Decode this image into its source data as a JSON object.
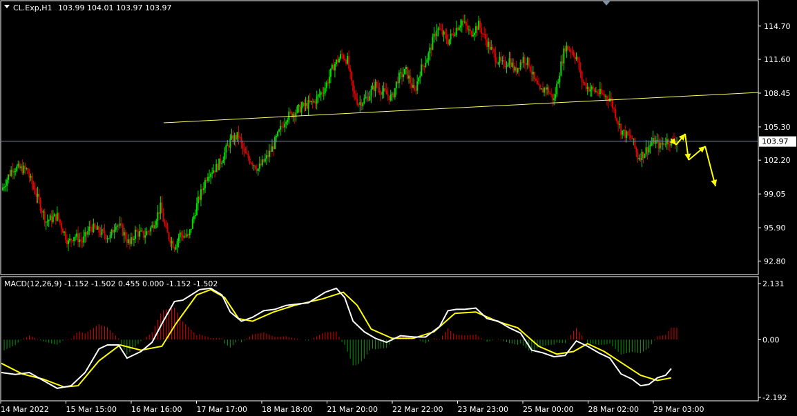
{
  "header": {
    "symbol": "CL.Exp,H1",
    "ohlc": "103.99 104.01 103.97 103.97"
  },
  "macd_header": {
    "text": "MACD(12,26,9) -1.152 -1.502 0.455 0.000 -1.152 -1.502"
  },
  "colors": {
    "background": "#000000",
    "frame": "#ffffff",
    "bull": "#00e000",
    "bear": "#e00000",
    "trendline": "#ffff66",
    "arrow": "#ffff00",
    "current_line": "#8090a0",
    "macd_line": "#ffffff",
    "signal_line": "#ffff00",
    "hist_pos": "#e00000",
    "hist_neg": "#00a000"
  },
  "chart_data": [
    {
      "type": "candlestick",
      "price_ticks": [
        "114.70",
        "111.60",
        "108.45",
        "105.30",
        "102.20",
        "99.05",
        "95.90",
        "92.80"
      ],
      "ylim": [
        91.6,
        117.0
      ],
      "current_price": "103.97",
      "time_labels": [
        "14 Mar 2022",
        "15 Mar 15:00",
        "16 Mar 16:00",
        "17 Mar 17:00",
        "18 Mar 18:00",
        "21 Mar 20:00",
        "22 Mar 22:00",
        "23 Mar 23:00",
        "25 Mar 00:00",
        "28 Mar 02:00",
        "29 Mar 03:00"
      ],
      "close_path": [
        [
          0,
          99.4
        ],
        [
          8,
          101.5
        ],
        [
          18,
          101.3
        ],
        [
          25,
          99.0
        ],
        [
          32,
          96.5
        ],
        [
          40,
          97.0
        ],
        [
          48,
          94.5
        ],
        [
          52,
          95.2
        ],
        [
          58,
          94.6
        ],
        [
          64,
          96.0
        ],
        [
          72,
          95.4
        ],
        [
          78,
          95.0
        ],
        [
          82,
          96.4
        ],
        [
          86,
          95.8
        ],
        [
          92,
          94.3
        ],
        [
          96,
          95.5
        ],
        [
          102,
          95.2
        ],
        [
          108,
          96.0
        ],
        [
          114,
          97.8
        ],
        [
          118,
          95.5
        ],
        [
          124,
          94.2
        ],
        [
          128,
          95.3
        ],
        [
          134,
          95.0
        ],
        [
          140,
          98.0
        ],
        [
          148,
          101.0
        ],
        [
          154,
          101.5
        ],
        [
          158,
          102.3
        ],
        [
          164,
          104.0
        ],
        [
          170,
          104.5
        ],
        [
          174,
          102.8
        ],
        [
          180,
          102.0
        ],
        [
          184,
          101.4
        ],
        [
          190,
          102.4
        ],
        [
          194,
          103.3
        ],
        [
          198,
          104.5
        ],
        [
          204,
          106.2
        ],
        [
          210,
          106.7
        ],
        [
          216,
          107.2
        ],
        [
          224,
          107.6
        ],
        [
          232,
          109.0
        ],
        [
          238,
          111.0
        ],
        [
          244,
          112.0
        ],
        [
          248,
          111.5
        ],
        [
          252,
          108.5
        ],
        [
          256,
          107.5
        ],
        [
          262,
          108.0
        ],
        [
          268,
          109.2
        ],
        [
          274,
          108.5
        ],
        [
          280,
          108.0
        ],
        [
          284,
          109.8
        ],
        [
          290,
          110.5
        ],
        [
          296,
          108.5
        ],
        [
          300,
          110.5
        ],
        [
          306,
          112.0
        ],
        [
          312,
          114.5
        ],
        [
          316,
          114.0
        ],
        [
          320,
          113.3
        ],
        [
          326,
          114.5
        ],
        [
          330,
          115.2
        ],
        [
          336,
          114.0
        ],
        [
          342,
          114.8
        ],
        [
          348,
          113.2
        ],
        [
          354,
          111.8
        ],
        [
          360,
          111.0
        ],
        [
          364,
          111.6
        ],
        [
          368,
          110.5
        ],
        [
          374,
          111.7
        ],
        [
          378,
          111.2
        ],
        [
          382,
          109.6
        ],
        [
          386,
          108.5
        ],
        [
          390,
          109.0
        ],
        [
          396,
          107.8
        ],
        [
          400,
          110.5
        ],
        [
          404,
          112.8
        ],
        [
          408,
          112.5
        ],
        [
          412,
          111.8
        ],
        [
          416,
          109.6
        ],
        [
          420,
          109.0
        ],
        [
          426,
          108.6
        ],
        [
          432,
          108.2
        ],
        [
          436,
          108.0
        ],
        [
          440,
          106.5
        ],
        [
          444,
          105.0
        ],
        [
          448,
          104.5
        ],
        [
          452,
          104.2
        ],
        [
          456,
          102.5
        ],
        [
          460,
          102.8
        ],
        [
          464,
          103.5
        ],
        [
          468,
          104.0
        ],
        [
          472,
          103.5
        ],
        [
          476,
          104.0
        ],
        [
          480,
          103.97
        ]
      ],
      "x_range": [
        0,
        484
      ]
    },
    {
      "type": "line",
      "title": "MACD(12,26,9)",
      "ticks": [
        "2.131",
        "0.00",
        "-2.192"
      ],
      "ylim": [
        -2.192,
        2.131
      ],
      "series": [
        {
          "name": "MACD",
          "points": [
            [
              0,
              -1.25
            ],
            [
              10,
              -1.32
            ],
            [
              20,
              -1.25
            ],
            [
              30,
              -1.55
            ],
            [
              40,
              -1.85
            ],
            [
              50,
              -1.75
            ],
            [
              60,
              -1.25
            ],
            [
              70,
              -0.35
            ],
            [
              76,
              -0.2
            ],
            [
              84,
              -0.2
            ],
            [
              90,
              -0.7
            ],
            [
              100,
              -0.45
            ],
            [
              108,
              -0.1
            ],
            [
              116,
              0.7
            ],
            [
              124,
              1.45
            ],
            [
              130,
              1.5
            ],
            [
              136,
              1.7
            ],
            [
              142,
              1.9
            ],
            [
              150,
              1.95
            ],
            [
              158,
              1.7
            ],
            [
              164,
              1.05
            ],
            [
              172,
              0.7
            ],
            [
              180,
              0.85
            ],
            [
              188,
              1.1
            ],
            [
              196,
              1.15
            ],
            [
              204,
              1.3
            ],
            [
              212,
              1.35
            ],
            [
              220,
              1.4
            ],
            [
              232,
              1.8
            ],
            [
              240,
              1.95
            ],
            [
              246,
              1.6
            ],
            [
              252,
              0.7
            ],
            [
              260,
              0.3
            ],
            [
              268,
              0.05
            ],
            [
              276,
              -0.1
            ],
            [
              286,
              0.15
            ],
            [
              296,
              0.1
            ],
            [
              304,
              0.1
            ],
            [
              314,
              0.5
            ],
            [
              320,
              1.1
            ],
            [
              326,
              1.15
            ],
            [
              332,
              1.15
            ],
            [
              340,
              1.2
            ],
            [
              348,
              0.8
            ],
            [
              356,
              0.7
            ],
            [
              364,
              0.45
            ],
            [
              372,
              0.25
            ],
            [
              380,
              -0.4
            ],
            [
              388,
              -0.5
            ],
            [
              396,
              -0.65
            ],
            [
              404,
              -0.6
            ],
            [
              412,
              -0.05
            ],
            [
              420,
              -0.25
            ],
            [
              428,
              -0.5
            ],
            [
              436,
              -0.7
            ],
            [
              444,
              -1.3
            ],
            [
              452,
              -1.5
            ],
            [
              458,
              -1.75
            ],
            [
              464,
              -1.7
            ],
            [
              470,
              -1.45
            ],
            [
              476,
              -1.35
            ],
            [
              480,
              -1.1
            ]
          ]
        },
        {
          "name": "Signal",
          "points": [
            [
              0,
              -0.9
            ],
            [
              15,
              -1.3
            ],
            [
              30,
              -1.5
            ],
            [
              45,
              -1.8
            ],
            [
              55,
              -1.75
            ],
            [
              70,
              -0.8
            ],
            [
              85,
              -0.2
            ],
            [
              100,
              -0.4
            ],
            [
              115,
              -0.25
            ],
            [
              125,
              0.6
            ],
            [
              140,
              1.7
            ],
            [
              150,
              1.9
            ],
            [
              160,
              1.6
            ],
            [
              170,
              0.8
            ],
            [
              180,
              0.7
            ],
            [
              195,
              1.05
            ],
            [
              210,
              1.3
            ],
            [
              230,
              1.55
            ],
            [
              245,
              1.8
            ],
            [
              255,
              1.3
            ],
            [
              265,
              0.4
            ],
            [
              280,
              0.05
            ],
            [
              295,
              0.05
            ],
            [
              310,
              0.3
            ],
            [
              325,
              1.0
            ],
            [
              340,
              1.05
            ],
            [
              355,
              0.7
            ],
            [
              370,
              0.45
            ],
            [
              385,
              -0.25
            ],
            [
              398,
              -0.55
            ],
            [
              410,
              -0.45
            ],
            [
              420,
              -0.15
            ],
            [
              432,
              -0.45
            ],
            [
              445,
              -0.9
            ],
            [
              458,
              -1.35
            ],
            [
              470,
              -1.55
            ],
            [
              480,
              -1.45
            ]
          ]
        }
      ]
    }
  ]
}
